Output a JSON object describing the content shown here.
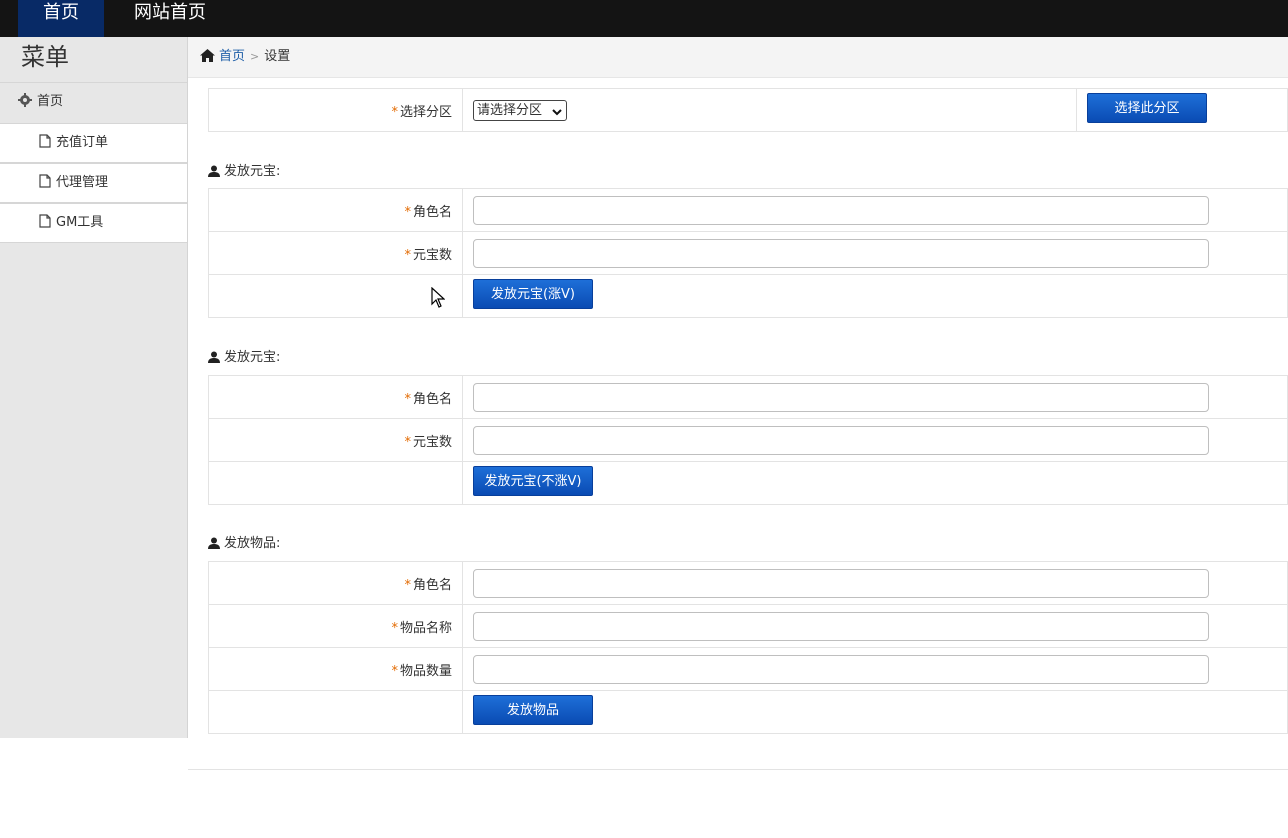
{
  "topbar": {
    "active_nav": "首页",
    "site_nav": "网站首页"
  },
  "sidebar": {
    "title": "菜单",
    "home": "首页",
    "items": [
      {
        "label": "充值订单"
      },
      {
        "label": "代理管理"
      },
      {
        "label": "GM工具"
      }
    ]
  },
  "breadcrumb": {
    "home": "首页",
    "current": "设置"
  },
  "partition": {
    "label": "选择分区",
    "select_value": "请选择分区",
    "button": "选择此分区"
  },
  "section1": {
    "title": "发放元宝:",
    "role_label": "角色名",
    "amount_label": "元宝数",
    "button": "发放元宝(涨V)"
  },
  "section2": {
    "title": "发放元宝:",
    "role_label": "角色名",
    "amount_label": "元宝数",
    "button": "发放元宝(不涨V)"
  },
  "section3": {
    "title": "发放物品:",
    "role_label": "角色名",
    "item_name_label": "物品名称",
    "item_qty_label": "物品数量",
    "button": "发放物品"
  },
  "colors": {
    "accent": "#0a4bb3",
    "required": "#e36a00",
    "topbar": "#141414"
  },
  "icons": {
    "home": "home-icon",
    "gear": "gear-icon",
    "page": "file-icon",
    "user": "user-icon",
    "chevron": "chevron-right-icon"
  }
}
